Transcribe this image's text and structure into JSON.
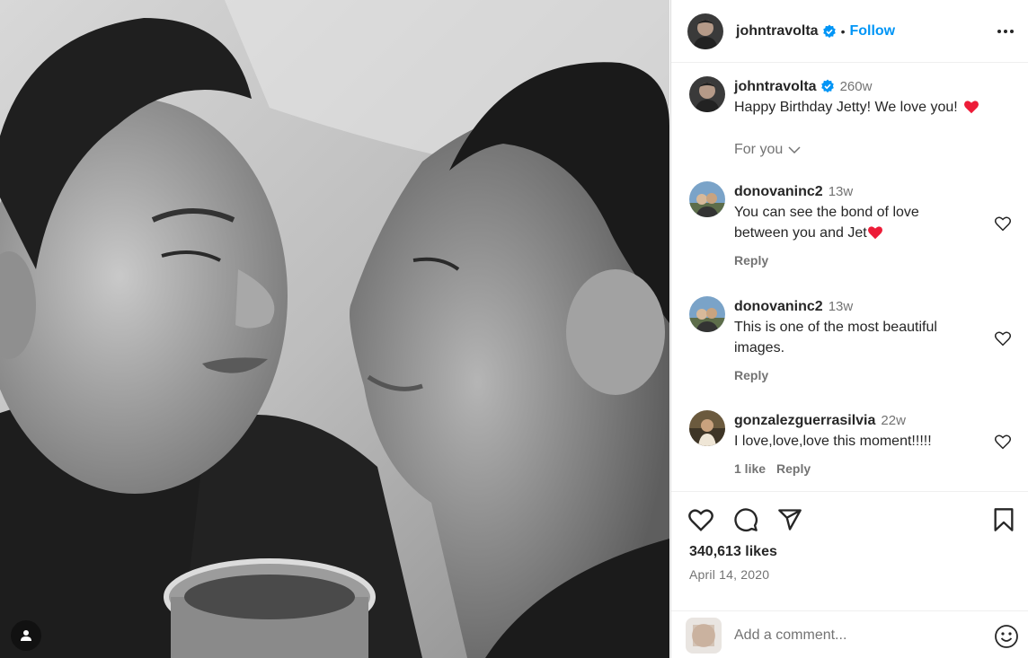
{
  "post": {
    "author": "johntravolta",
    "follow_label": "Follow",
    "separator": "•",
    "caption": {
      "username": "johntravolta",
      "timestamp": "260w",
      "text": "Happy Birthday Jetty! We love you!"
    },
    "for_you_label": "For you",
    "comments": [
      {
        "username": "donovaninc2",
        "timestamp": "13w",
        "text": "You can see the bond of love",
        "text2": "between you and Jet",
        "reply_label": "Reply"
      },
      {
        "username": "donovaninc2",
        "timestamp": "13w",
        "text": "This is one of the most beautiful",
        "text2": "images.",
        "reply_label": "Reply"
      },
      {
        "username": "gonzalezguerrasilvia",
        "timestamp": "22w",
        "text": "I love,love,love this moment!!!!!",
        "likes_label": "1 like",
        "reply_label": "Reply"
      }
    ],
    "likes": "340,613 likes",
    "date": "April 14, 2020",
    "comment_placeholder": "Add a comment..."
  },
  "colors": {
    "accent": "#0095f6",
    "heart_red": "#ed1c38",
    "verified_blue": "#0095f6",
    "muted": "#737373"
  },
  "icons": [
    "verified-icon",
    "more-icon",
    "chevron-down-icon",
    "heart-icon",
    "comment-icon",
    "share-icon",
    "bookmark-icon",
    "emoji-icon",
    "user-tag-icon"
  ]
}
